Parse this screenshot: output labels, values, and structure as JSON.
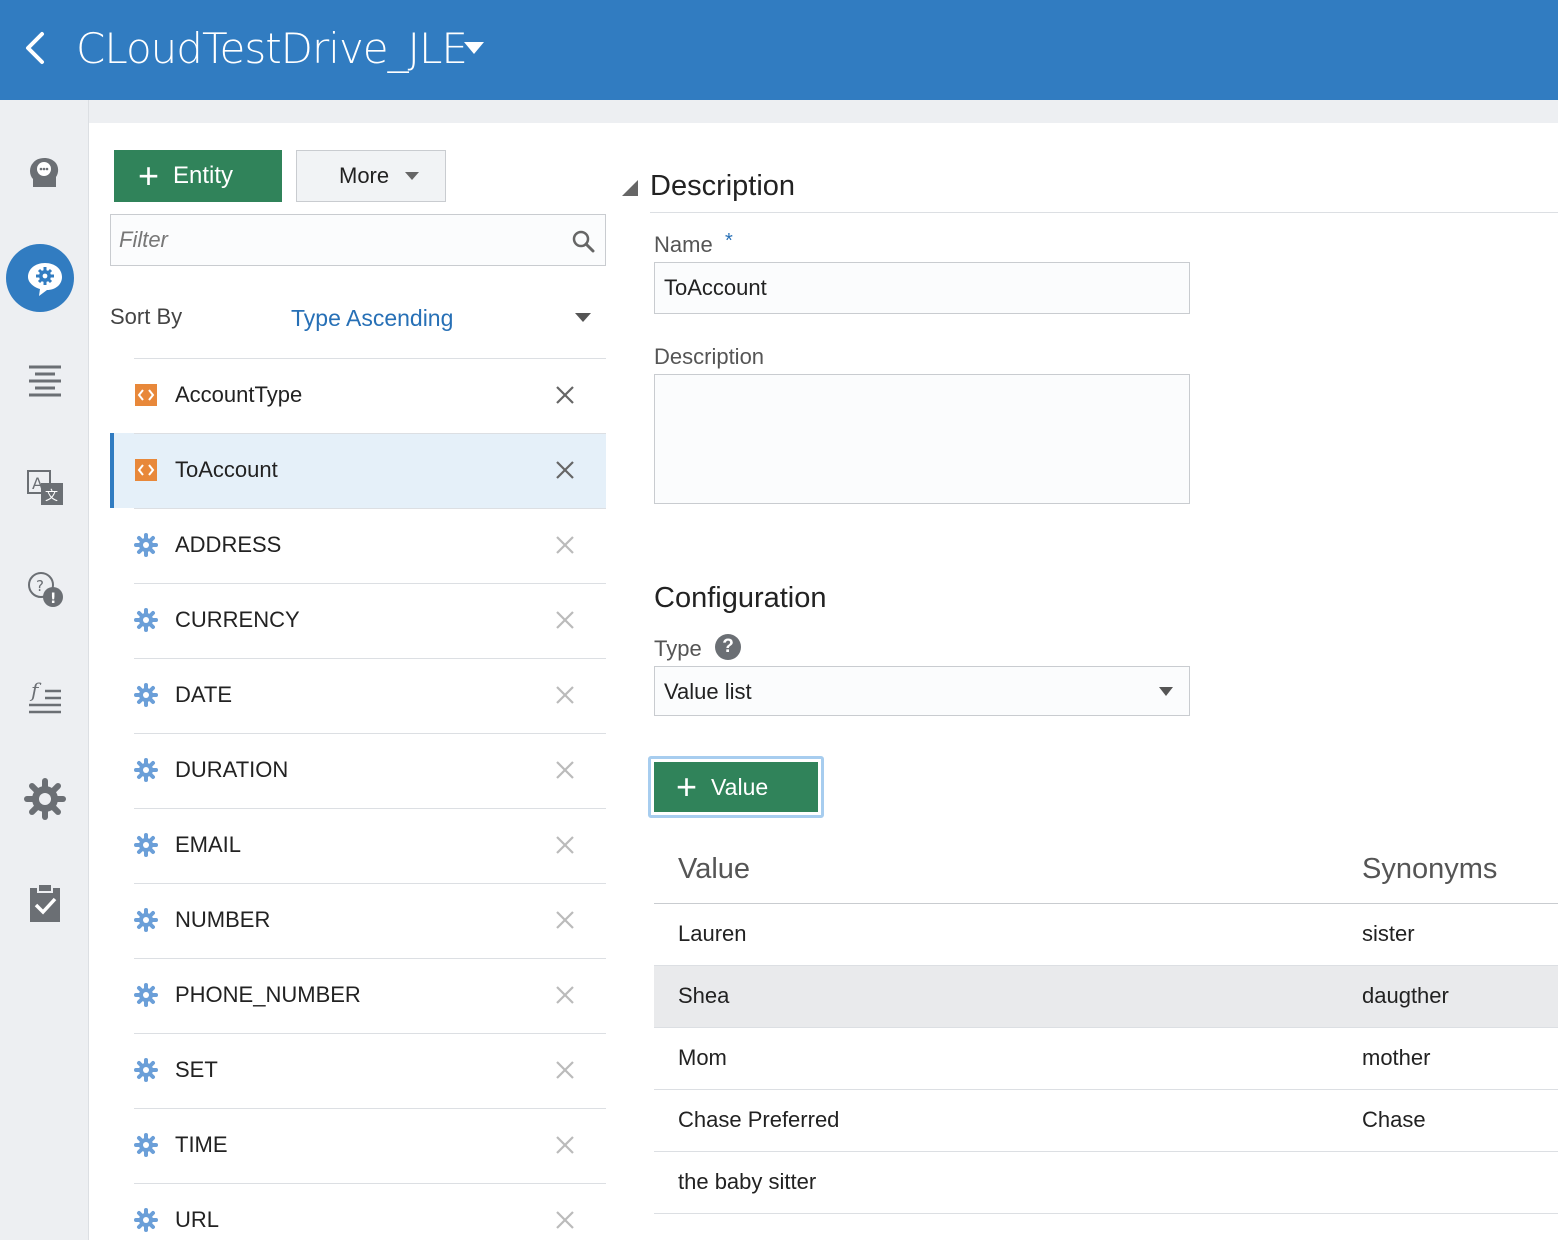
{
  "header": {
    "title": "CLoudTestDrive_JLE"
  },
  "rail": {
    "items": [
      {
        "name": "intents-icon"
      },
      {
        "name": "entities-icon"
      },
      {
        "name": "flows-icon"
      },
      {
        "name": "resource-bundles-icon"
      },
      {
        "name": "faq-icon"
      },
      {
        "name": "components-icon"
      },
      {
        "name": "settings-icon"
      },
      {
        "name": "quality-icon"
      }
    ]
  },
  "toolbar": {
    "add_entity_label": "Entity",
    "more_label": "More"
  },
  "filter": {
    "placeholder": "Filter"
  },
  "sort": {
    "label": "Sort By",
    "value": "Type Ascending"
  },
  "entities": [
    {
      "label": "AccountType",
      "kind": "custom"
    },
    {
      "label": "ToAccount",
      "kind": "custom",
      "selected": true
    },
    {
      "label": "ADDRESS",
      "kind": "system"
    },
    {
      "label": "CURRENCY",
      "kind": "system"
    },
    {
      "label": "DATE",
      "kind": "system"
    },
    {
      "label": "DURATION",
      "kind": "system"
    },
    {
      "label": "EMAIL",
      "kind": "system"
    },
    {
      "label": "NUMBER",
      "kind": "system"
    },
    {
      "label": "PHONE_NUMBER",
      "kind": "system"
    },
    {
      "label": "SET",
      "kind": "system"
    },
    {
      "label": "TIME",
      "kind": "system"
    },
    {
      "label": "URL",
      "kind": "system"
    }
  ],
  "detail": {
    "description_section": "Description",
    "name_label": "Name",
    "required_mark": "*",
    "name_value": "ToAccount",
    "description_label": "Description",
    "description_value": "",
    "configuration_section": "Configuration",
    "type_label": "Type",
    "help_glyph": "?",
    "type_value": "Value list",
    "add_value_label": "Value"
  },
  "values_table": {
    "columns": [
      "Value",
      "Synonyms"
    ],
    "rows": [
      {
        "value": "Lauren",
        "synonyms": "sister"
      },
      {
        "value": "Shea",
        "synonyms": "daugther"
      },
      {
        "value": "Mom",
        "synonyms": "mother"
      },
      {
        "value": "Chase Preferred",
        "synonyms": "Chase"
      },
      {
        "value": "the baby sitter",
        "synonyms": ""
      }
    ]
  },
  "colors": {
    "header": "#317cc1",
    "primary_button": "#30835a",
    "link": "#2770b6",
    "custom_entity_icon": "#e8883a",
    "system_entity_icon": "#6b9fd8"
  }
}
